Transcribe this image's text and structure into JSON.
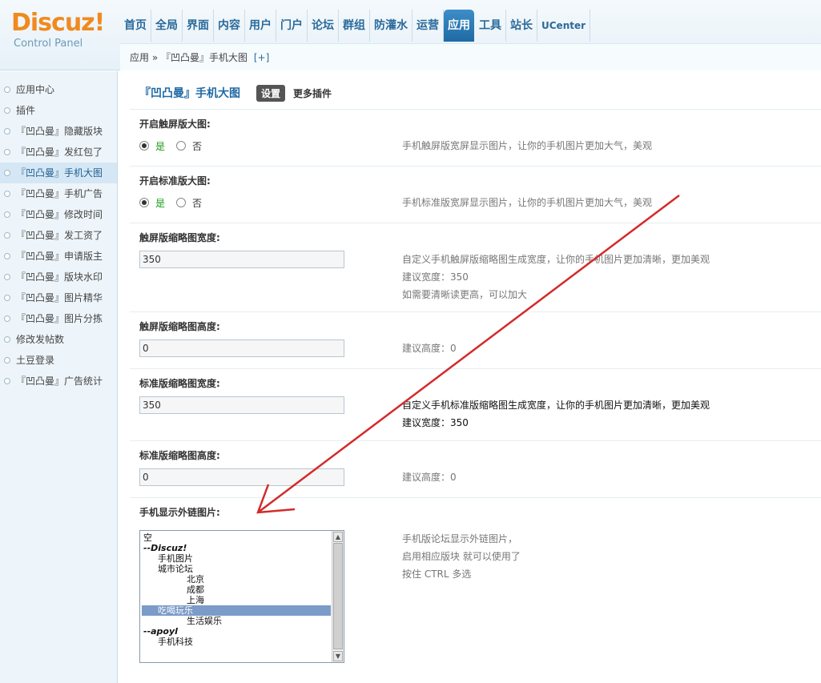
{
  "logo": {
    "brand": "Discuz!",
    "subtitle": "Control Panel"
  },
  "topnav": {
    "items": [
      "首页",
      "全局",
      "界面",
      "内容",
      "用户",
      "门户",
      "论坛",
      "群组",
      "防灌水",
      "运营",
      "应用",
      "工具",
      "站长",
      "UCenter"
    ],
    "active_index": 10
  },
  "breadcrumb": {
    "section": "应用",
    "separator": "»",
    "current": "『凹凸曼』手机大图",
    "add": "[+]"
  },
  "sidebar": {
    "items": [
      "应用中心",
      "插件",
      "『凹凸曼』隐藏版块",
      "『凹凸曼』发红包了",
      "『凹凸曼』手机大图",
      "『凹凸曼』手机广告",
      "『凹凸曼』修改时间",
      "『凹凸曼』发工资了",
      "『凹凸曼』申请版主",
      "『凹凸曼』版块水印",
      "『凹凸曼』图片精华",
      "『凹凸曼』图片分拣",
      "修改发帖数",
      "土豆登录",
      "『凹凸曼』广告统计"
    ],
    "active_index": 4
  },
  "main": {
    "title": "『凹凸曼』手机大图",
    "tab_settings": "设置",
    "tab_more": "更多插件",
    "touch_big": {
      "label": "开启触屏版大图:",
      "yes": "是",
      "no": "否",
      "selected": "是",
      "desc": "手机触屏版宽屏显示图片，让你的手机图片更加大气，美观"
    },
    "std_big": {
      "label": "开启标准版大图:",
      "yes": "是",
      "no": "否",
      "selected": "是",
      "desc": "手机标准版宽屏显示图片，让你的手机图片更加大气，美观"
    },
    "touch_thumb_width": {
      "label": "触屏版缩略图宽度:",
      "value": "350",
      "desc1": "自定义手机触屏版缩略图生成宽度，让你的手机图片更加清晰，更加美观",
      "desc2": "建议宽度：350",
      "desc3": "如需要清晰读更高，可以加大"
    },
    "touch_thumb_height": {
      "label": "触屏版缩略图高度:",
      "value": "0",
      "desc1": "建议高度：0"
    },
    "std_thumb_width": {
      "label": "标准版缩略图宽度:",
      "value": "350",
      "desc1": "自定义手机标准版缩略图生成宽度，让你的手机图片更加清晰，更加美观",
      "desc2": "建议宽度：350"
    },
    "std_thumb_height": {
      "label": "标准版缩略图高度:",
      "value": "0",
      "desc1": "建议高度：0"
    },
    "external_images": {
      "label": "手机显示外链图片:",
      "options": [
        {
          "text": "空",
          "indent": 0,
          "group": false,
          "selected": false
        },
        {
          "text": "--Discuz!",
          "indent": 0,
          "group": true,
          "selected": false
        },
        {
          "text": "手机图片",
          "indent": 1,
          "group": false,
          "selected": false
        },
        {
          "text": "城市论坛",
          "indent": 1,
          "group": false,
          "selected": false
        },
        {
          "text": "北京",
          "indent": 2,
          "group": false,
          "selected": false
        },
        {
          "text": "成都",
          "indent": 2,
          "group": false,
          "selected": false
        },
        {
          "text": "上海",
          "indent": 2,
          "group": false,
          "selected": false
        },
        {
          "text": "吃喝玩乐",
          "indent": 1,
          "group": false,
          "selected": true
        },
        {
          "text": "生活娱乐",
          "indent": 2,
          "group": false,
          "selected": false
        },
        {
          "text": "--apoyl",
          "indent": 0,
          "group": true,
          "selected": false
        },
        {
          "text": "手机科技",
          "indent": 1,
          "group": false,
          "selected": false
        }
      ],
      "desc1": "手机版论坛显示外链图片，",
      "desc2": "启用相应版块 就可以使用了",
      "desc3": "按住 CTRL 多选"
    }
  },
  "annotation_color": "#d42a2a"
}
